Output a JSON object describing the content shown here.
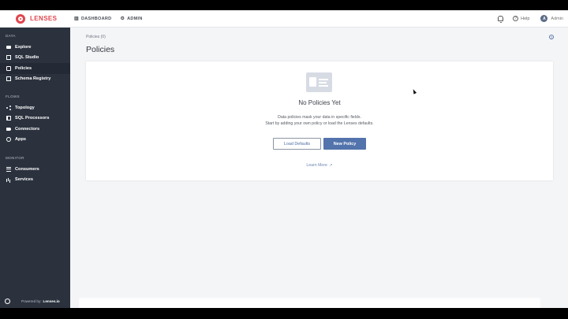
{
  "brand": {
    "name": "LENSES"
  },
  "topnav": [
    {
      "icon": "bar-chart-icon",
      "label": "DASHBOARD"
    },
    {
      "icon": "gear-icon",
      "label": "ADMIN"
    }
  ],
  "topright": {
    "help": "Help",
    "user": "Admin",
    "avatar_letter": "A"
  },
  "sidebar": {
    "data_label": "DATA",
    "data_items": [
      "Explore",
      "SQL Studio",
      "Policies",
      "Schema Registry"
    ],
    "flows_label": "FLOWS",
    "flows_items": [
      "Topology",
      "SQL Processors",
      "Connectors",
      "Apps"
    ],
    "monitor_label": "MONITOR",
    "monitor_items": [
      "Consumers",
      "Services"
    ],
    "powered_prefix": "Powered by:",
    "powered_brand": "Lenses.io"
  },
  "main": {
    "breadcrumb": "Policies (0)",
    "title": "Policies",
    "empty_title": "No Policies Yet",
    "empty_line1": "Data policies mask your data in specific fields.",
    "empty_line2": "Start by adding your own policy or load the Lenses defaults.",
    "load_defaults": "Load Defaults",
    "new_policy": "New Policy",
    "learn_more": "Learn More"
  }
}
